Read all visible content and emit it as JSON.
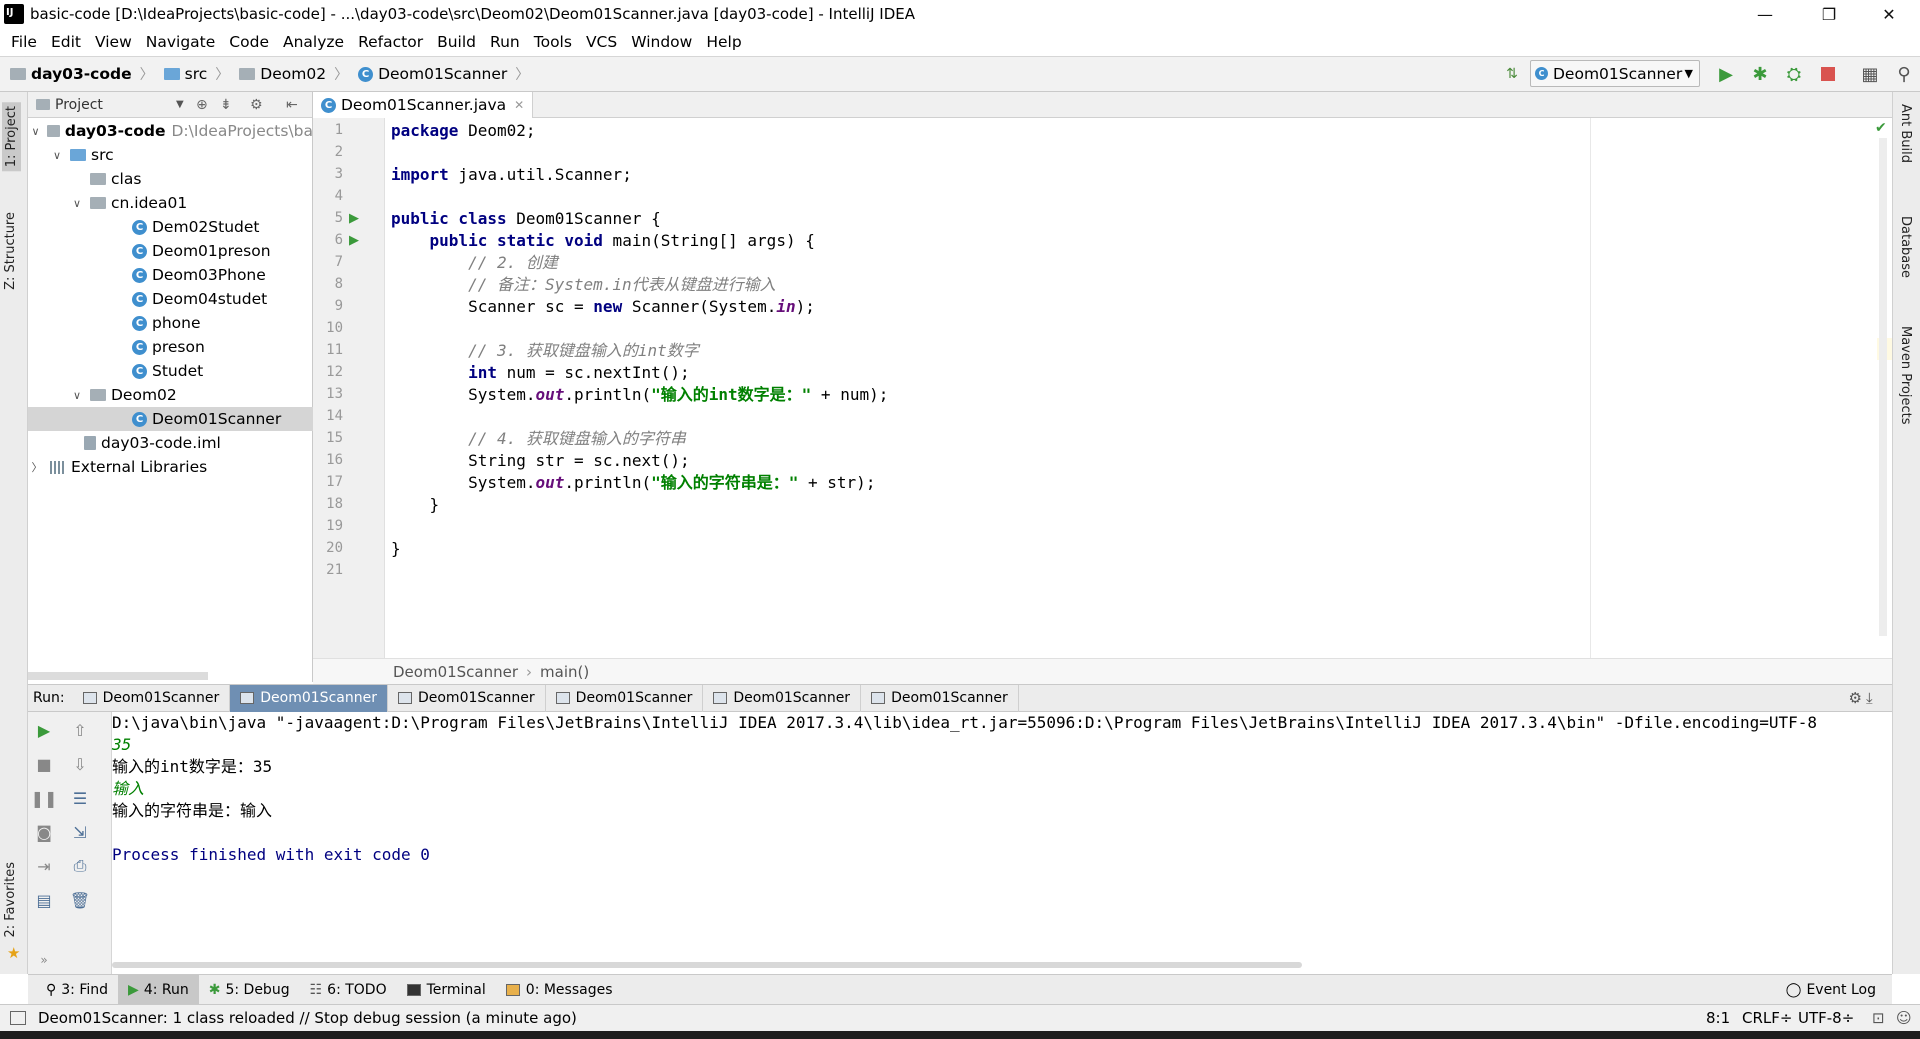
{
  "window": {
    "title": "basic-code [D:\\IdeaProjects\\basic-code] - ...\\day03-code\\src\\Deom02\\Deom01Scanner.java [day03-code] - IntelliJ IDEA",
    "minimize": "—",
    "maximize": "❐",
    "close": "✕"
  },
  "menu": [
    "File",
    "Edit",
    "View",
    "Navigate",
    "Code",
    "Analyze",
    "Refactor",
    "Build",
    "Run",
    "Tools",
    "VCS",
    "Window",
    "Help"
  ],
  "breadcrumbs": [
    "day03-code",
    "src",
    "Deom02",
    "Deom01Scanner"
  ],
  "run_config": "Deom01Scanner",
  "left_stripe": {
    "project": "1: Project",
    "structure": "Z: Structure",
    "favorites": "2: Favorites"
  },
  "right_stripe": {
    "ant": "Ant Build",
    "database": "Database",
    "maven": "Maven Projects"
  },
  "project": {
    "header": "Project",
    "root_name": "day03-code",
    "root_path": "D:\\IdeaProjects\\ba",
    "src": "src",
    "clas": "clas",
    "pkg1": "cn.idea01",
    "pkg1_items": [
      "Dem02Studet",
      "Deom01preson",
      "Deom03Phone",
      "Deom04studet",
      "phone",
      "preson",
      "Studet"
    ],
    "pkg2": "Deom02",
    "pkg2_item": "Deom01Scanner",
    "iml": "day03-code.iml",
    "ext": "External Libraries"
  },
  "editor": {
    "tab": "Deom01Scanner.java",
    "line_numbers": [
      "1",
      "2",
      "3",
      "4",
      "5",
      "6",
      "7",
      "8",
      "9",
      "10",
      "11",
      "12",
      "13",
      "14",
      "15",
      "16",
      "17",
      "18",
      "19",
      "20",
      "21"
    ],
    "bottom_crumb_class": "Deom01Scanner",
    "bottom_crumb_method": "main()"
  },
  "run": {
    "label": "Run:",
    "tabs": [
      "Deom01Scanner",
      "Deom01Scanner",
      "Deom01Scanner",
      "Deom01Scanner",
      "Deom01Scanner",
      "Deom01Scanner"
    ],
    "console": {
      "cmd": "D:\\java\\bin\\java \"-javaagent:D:\\Program Files\\JetBrains\\IntelliJ IDEA 2017.3.4\\lib\\idea_rt.jar=55096:D:\\Program Files\\JetBrains\\IntelliJ IDEA 2017.3.4\\bin\" -Dfile.encoding=UTF-8",
      "in1": "35",
      "out1": "输入的int数字是：35",
      "in2": "输入",
      "out2": "输入的字符串是：输入",
      "exit": "Process finished with exit code 0"
    }
  },
  "tool_tabs": {
    "find": "3: Find",
    "run": "4: Run",
    "debug": "5: Debug",
    "todo": "6: TODO",
    "terminal": "Terminal",
    "messages": "0: Messages",
    "event_log": "Event Log"
  },
  "status": {
    "message": "Deom01Scanner: 1 class reloaded // Stop debug session (a minute ago)",
    "position": "8:1",
    "line_sep": "CRLF÷",
    "encoding": "UTF-8÷"
  }
}
